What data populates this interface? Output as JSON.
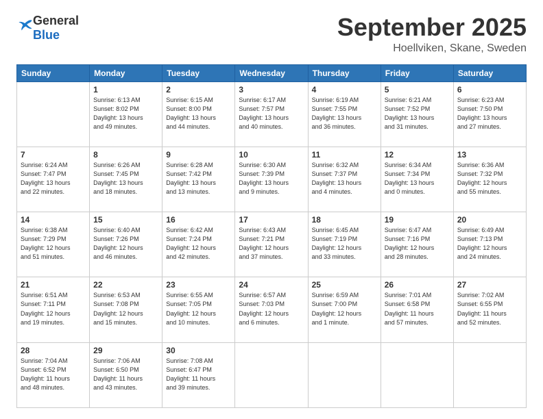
{
  "header": {
    "logo_general": "General",
    "logo_blue": "Blue",
    "month_title": "September 2025",
    "location": "Hoellviken, Skane, Sweden"
  },
  "days_of_week": [
    "Sunday",
    "Monday",
    "Tuesday",
    "Wednesday",
    "Thursday",
    "Friday",
    "Saturday"
  ],
  "weeks": [
    [
      {
        "day": "",
        "info": ""
      },
      {
        "day": "1",
        "info": "Sunrise: 6:13 AM\nSunset: 8:02 PM\nDaylight: 13 hours\nand 49 minutes."
      },
      {
        "day": "2",
        "info": "Sunrise: 6:15 AM\nSunset: 8:00 PM\nDaylight: 13 hours\nand 44 minutes."
      },
      {
        "day": "3",
        "info": "Sunrise: 6:17 AM\nSunset: 7:57 PM\nDaylight: 13 hours\nand 40 minutes."
      },
      {
        "day": "4",
        "info": "Sunrise: 6:19 AM\nSunset: 7:55 PM\nDaylight: 13 hours\nand 36 minutes."
      },
      {
        "day": "5",
        "info": "Sunrise: 6:21 AM\nSunset: 7:52 PM\nDaylight: 13 hours\nand 31 minutes."
      },
      {
        "day": "6",
        "info": "Sunrise: 6:23 AM\nSunset: 7:50 PM\nDaylight: 13 hours\nand 27 minutes."
      }
    ],
    [
      {
        "day": "7",
        "info": "Sunrise: 6:24 AM\nSunset: 7:47 PM\nDaylight: 13 hours\nand 22 minutes."
      },
      {
        "day": "8",
        "info": "Sunrise: 6:26 AM\nSunset: 7:45 PM\nDaylight: 13 hours\nand 18 minutes."
      },
      {
        "day": "9",
        "info": "Sunrise: 6:28 AM\nSunset: 7:42 PM\nDaylight: 13 hours\nand 13 minutes."
      },
      {
        "day": "10",
        "info": "Sunrise: 6:30 AM\nSunset: 7:39 PM\nDaylight: 13 hours\nand 9 minutes."
      },
      {
        "day": "11",
        "info": "Sunrise: 6:32 AM\nSunset: 7:37 PM\nDaylight: 13 hours\nand 4 minutes."
      },
      {
        "day": "12",
        "info": "Sunrise: 6:34 AM\nSunset: 7:34 PM\nDaylight: 13 hours\nand 0 minutes."
      },
      {
        "day": "13",
        "info": "Sunrise: 6:36 AM\nSunset: 7:32 PM\nDaylight: 12 hours\nand 55 minutes."
      }
    ],
    [
      {
        "day": "14",
        "info": "Sunrise: 6:38 AM\nSunset: 7:29 PM\nDaylight: 12 hours\nand 51 minutes."
      },
      {
        "day": "15",
        "info": "Sunrise: 6:40 AM\nSunset: 7:26 PM\nDaylight: 12 hours\nand 46 minutes."
      },
      {
        "day": "16",
        "info": "Sunrise: 6:42 AM\nSunset: 7:24 PM\nDaylight: 12 hours\nand 42 minutes."
      },
      {
        "day": "17",
        "info": "Sunrise: 6:43 AM\nSunset: 7:21 PM\nDaylight: 12 hours\nand 37 minutes."
      },
      {
        "day": "18",
        "info": "Sunrise: 6:45 AM\nSunset: 7:19 PM\nDaylight: 12 hours\nand 33 minutes."
      },
      {
        "day": "19",
        "info": "Sunrise: 6:47 AM\nSunset: 7:16 PM\nDaylight: 12 hours\nand 28 minutes."
      },
      {
        "day": "20",
        "info": "Sunrise: 6:49 AM\nSunset: 7:13 PM\nDaylight: 12 hours\nand 24 minutes."
      }
    ],
    [
      {
        "day": "21",
        "info": "Sunrise: 6:51 AM\nSunset: 7:11 PM\nDaylight: 12 hours\nand 19 minutes."
      },
      {
        "day": "22",
        "info": "Sunrise: 6:53 AM\nSunset: 7:08 PM\nDaylight: 12 hours\nand 15 minutes."
      },
      {
        "day": "23",
        "info": "Sunrise: 6:55 AM\nSunset: 7:05 PM\nDaylight: 12 hours\nand 10 minutes."
      },
      {
        "day": "24",
        "info": "Sunrise: 6:57 AM\nSunset: 7:03 PM\nDaylight: 12 hours\nand 6 minutes."
      },
      {
        "day": "25",
        "info": "Sunrise: 6:59 AM\nSunset: 7:00 PM\nDaylight: 12 hours\nand 1 minute."
      },
      {
        "day": "26",
        "info": "Sunrise: 7:01 AM\nSunset: 6:58 PM\nDaylight: 11 hours\nand 57 minutes."
      },
      {
        "day": "27",
        "info": "Sunrise: 7:02 AM\nSunset: 6:55 PM\nDaylight: 11 hours\nand 52 minutes."
      }
    ],
    [
      {
        "day": "28",
        "info": "Sunrise: 7:04 AM\nSunset: 6:52 PM\nDaylight: 11 hours\nand 48 minutes."
      },
      {
        "day": "29",
        "info": "Sunrise: 7:06 AM\nSunset: 6:50 PM\nDaylight: 11 hours\nand 43 minutes."
      },
      {
        "day": "30",
        "info": "Sunrise: 7:08 AM\nSunset: 6:47 PM\nDaylight: 11 hours\nand 39 minutes."
      },
      {
        "day": "",
        "info": ""
      },
      {
        "day": "",
        "info": ""
      },
      {
        "day": "",
        "info": ""
      },
      {
        "day": "",
        "info": ""
      }
    ]
  ]
}
